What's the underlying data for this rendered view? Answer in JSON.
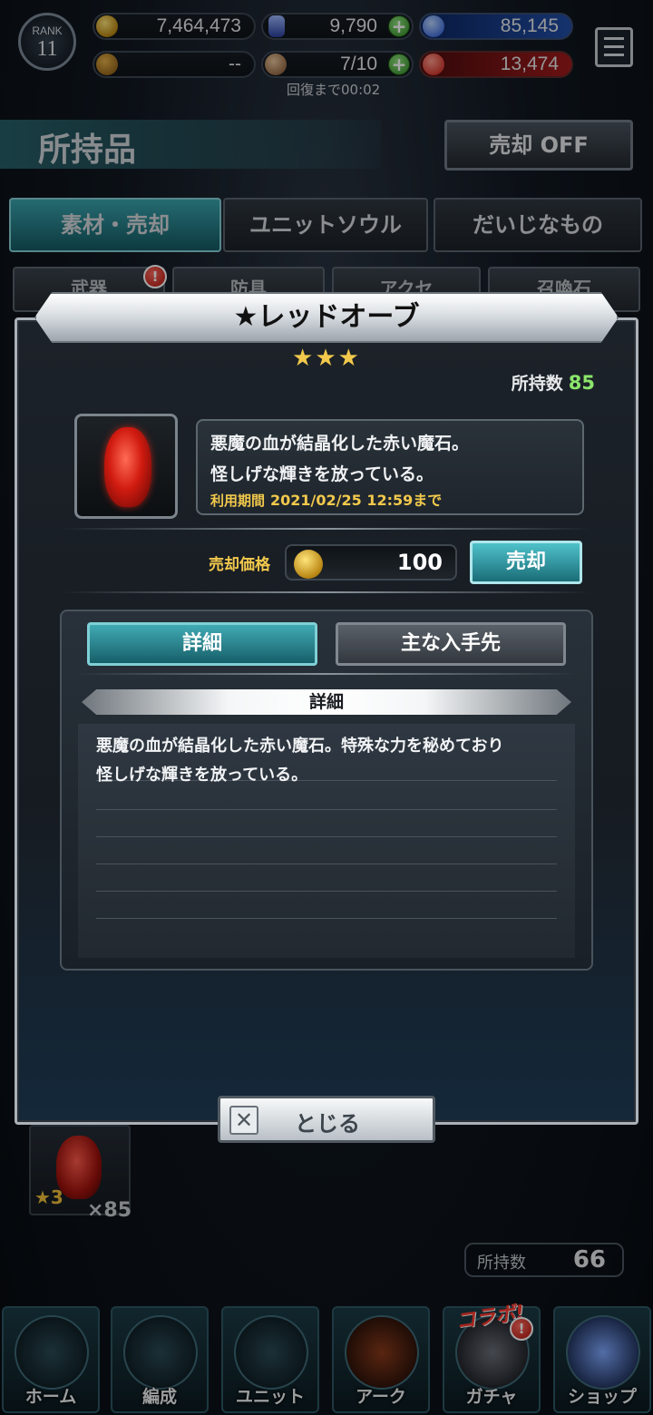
{
  "header": {
    "rank_label": "RANK",
    "rank_value": "11",
    "gold": "7,464,473",
    "crystals": "9,790",
    "blue_points": "85,145",
    "trophy": "--",
    "stamina": "7/10",
    "red_points": "13,474",
    "recover": "回復まで00:02",
    "plus": "+"
  },
  "page": {
    "title": "所持品",
    "sell_toggle": "売却 OFF",
    "category_tabs": [
      "素材・売却",
      "ユニットソウル",
      "だいじなもの"
    ],
    "sub_tabs": [
      "武器",
      "防具",
      "アクセ",
      "召喚石"
    ],
    "sub_badge": "!",
    "item_rarity": "★3",
    "item_count": "×85",
    "own_label": "所持数",
    "own_value": "66"
  },
  "modal": {
    "title": "★レッドオーブ",
    "rarity": "★★★",
    "own_label": "所持数",
    "own_value": "85",
    "desc_line1": "悪魔の血が結晶化した赤い魔石。",
    "desc_line2": "怪しげな輝きを放っている。",
    "expire_label": "利用期間",
    "expire_value": "2021/02/25 12:59まで",
    "price_label": "売却価格",
    "price_value": "100",
    "sell_button": "売却",
    "tab_detail": "詳細",
    "tab_source": "主な入手先",
    "section_title": "詳細",
    "detail_line1": "悪魔の血が結晶化した赤い魔石。特殊な力を秘めており",
    "detail_line2": "怪しげな輝きを放っている。",
    "close_x": "✕",
    "close_label": "とじる"
  },
  "nav": {
    "items": [
      "ホーム",
      "編成",
      "ユニット",
      "アーク",
      "ガチャ",
      "ショップ"
    ],
    "collab": "コラボ!",
    "badge": "!"
  },
  "colors": {
    "accent_teal": "#41aab4",
    "gold_text": "#f2c94c",
    "count_green": "#8be56b"
  }
}
